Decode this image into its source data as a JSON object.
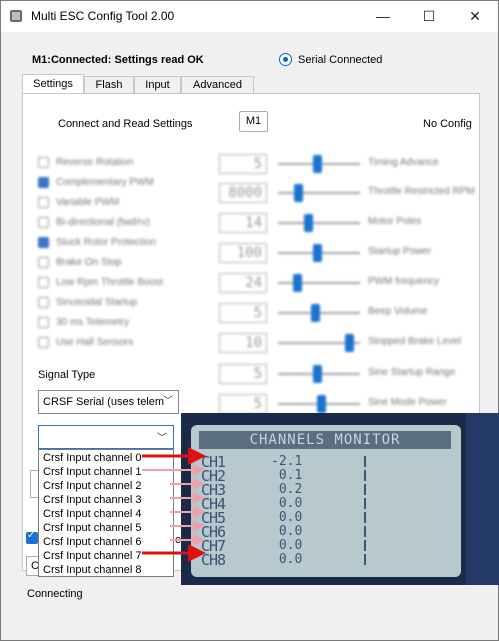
{
  "window": {
    "title": "Multi ESC Config Tool 2.00",
    "minimize_glyph": "—",
    "maximize_glyph": "☐",
    "close_glyph": "✕"
  },
  "status_line": "M1:Connected: Settings read OK",
  "serial_radio_label": "Serial Connected",
  "tabs": [
    "Settings",
    "Flash",
    "Input",
    "Advanced"
  ],
  "settings": {
    "connect_label": "Connect and Read Settings",
    "m1_button": "M1",
    "config_label": "No Config",
    "checkboxes": [
      {
        "label": "Reverse Rotation",
        "checked": false
      },
      {
        "label": "Complementary PWM",
        "checked": true
      },
      {
        "label": "Variable PWM",
        "checked": false
      },
      {
        "label": "Bi-directional (fwd/rv)",
        "checked": false
      },
      {
        "label": "Stuck Rotor Protection",
        "checked": true
      },
      {
        "label": "Brake On Stop",
        "checked": false
      },
      {
        "label": "Low Rpm Throttle Boost",
        "checked": false
      },
      {
        "label": "Sinusoidal Startup",
        "checked": false
      },
      {
        "label": "30 ms Telemetry",
        "checked": false
      },
      {
        "label": "Use Hall Sensors",
        "checked": false
      }
    ],
    "sliders": [
      {
        "value": "5",
        "label": "Timing Advance",
        "level": 0.48
      },
      {
        "value": "8000",
        "label": "Throttle Restricted RPM",
        "level": 0.22
      },
      {
        "value": "14",
        "label": "Motor Poles",
        "level": 0.35
      },
      {
        "value": "100",
        "label": "Startup Power",
        "level": 0.48
      },
      {
        "value": "24",
        "label": "PWM frequency",
        "level": 0.2
      },
      {
        "value": "5",
        "label": "Beep Volume",
        "level": 0.45
      },
      {
        "value": "10",
        "label": "Stopped Brake Level",
        "level": 0.92
      },
      {
        "value": "5",
        "label": "Sine Startup Range",
        "level": 0.48
      },
      {
        "value": "5",
        "label": "Sine Mode Power",
        "level": 0.54
      }
    ],
    "signal_type_label": "Signal Type",
    "signal_type_value": "CRSF Serial (uses telem",
    "channel_select_value": "",
    "channel_options": [
      "Crsf Input channel 0",
      "Crsf Input channel 1",
      "Crsf Input channel 2",
      "Crsf Input channel 3",
      "Crsf Input channel 4",
      "Crsf Input channel 5",
      "Crsf Input channel 6",
      "Crsf Input channel 7",
      "Crsf Input channel 8"
    ],
    "partial_text": "ed",
    "partial_button": "C"
  },
  "bottom_status": "Connecting",
  "monitor": {
    "title": "CHANNELS MONITOR",
    "rows": [
      {
        "ch": "CH1",
        "value": "-2.1"
      },
      {
        "ch": "CH2",
        "value": " 0.1"
      },
      {
        "ch": "CH3",
        "value": " 0.2"
      },
      {
        "ch": "CH4",
        "value": " 0.0"
      },
      {
        "ch": "CH5",
        "value": " 0.0"
      },
      {
        "ch": "CH6",
        "value": " 0.0"
      },
      {
        "ch": "CH7",
        "value": " 0.0"
      },
      {
        "ch": "CH8",
        "value": " 0.0"
      }
    ]
  },
  "colors": {
    "accent": "#1a73d0",
    "arrow_strong": "#e01010",
    "arrow_faint": "#f0a0a8",
    "lcd_bg": "#b7c9cd",
    "lcd_text": "#3b5472"
  }
}
